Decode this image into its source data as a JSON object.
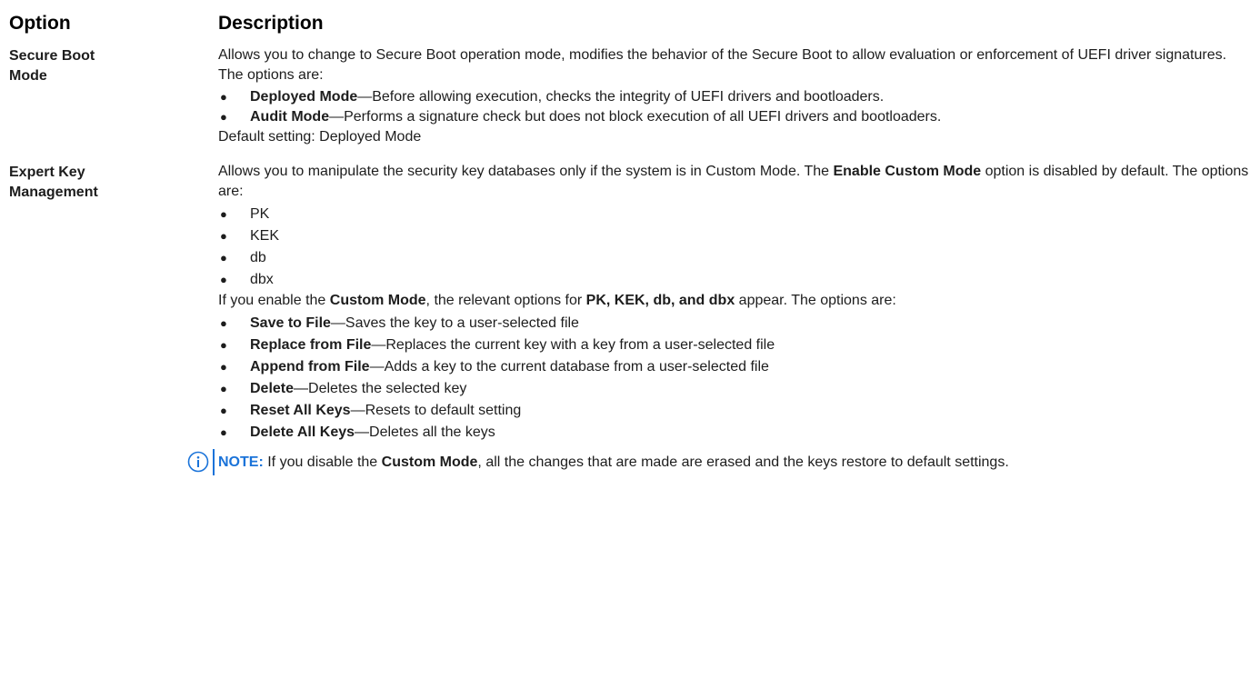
{
  "table": {
    "header": {
      "option": "Option",
      "description": "Description"
    },
    "secure_boot": {
      "option_line1": "Secure Boot",
      "option_line2": "Mode",
      "intro": "Allows you to change to Secure Boot operation mode, modifies the behavior of the Secure Boot to allow evaluation or enforcement of UEFI driver signatures. The options are:",
      "items": [
        {
          "bold": "Deployed Mode",
          "text": "—Before allowing execution, checks the integrity of UEFI drivers and bootloaders."
        },
        {
          "bold": "Audit Mode",
          "text": "—Performs a signature check but does not block execution of all UEFI drivers and bootloaders."
        }
      ],
      "default": "Default setting: Deployed Mode"
    },
    "expert_key": {
      "option_line1": "Expert Key",
      "option_line2": "Management",
      "intro_pre": "Allows you to manipulate the security key databases only if the system is in Custom Mode. The ",
      "intro_bold": "Enable Custom Mode",
      "intro_post": " option is disabled by default. The options are:",
      "keys": [
        "PK",
        "KEK",
        "db",
        "dbx"
      ],
      "custom_pre": "If you enable the ",
      "custom_bold1": "Custom Mode",
      "custom_mid": ", the relevant options for ",
      "custom_bold2": "PK, KEK, db, and dbx",
      "custom_post": " appear. The options are:",
      "actions": [
        {
          "bold": "Save to File",
          "text": "—Saves the key to a user-selected file"
        },
        {
          "bold": "Replace from File",
          "text": "—Replaces the current key with a key from a user-selected file"
        },
        {
          "bold": "Append from File",
          "text": "—Adds a key to the current database from a user-selected file"
        },
        {
          "bold": "Delete",
          "text": "—Deletes the selected key"
        },
        {
          "bold": "Reset All Keys",
          "text": "—Resets to default setting"
        },
        {
          "bold": "Delete All Keys",
          "text": "—Deletes all the keys"
        }
      ],
      "note": {
        "label": "NOTE:",
        "pre": " If you disable the ",
        "bold": "Custom Mode",
        "post": ", all the changes that are made are erased and the keys restore to default settings."
      }
    }
  },
  "colors": {
    "note_accent": "#1a73d9",
    "text": "#1d1d1d"
  },
  "icons": {
    "bullet": "●",
    "note": "info-icon"
  }
}
